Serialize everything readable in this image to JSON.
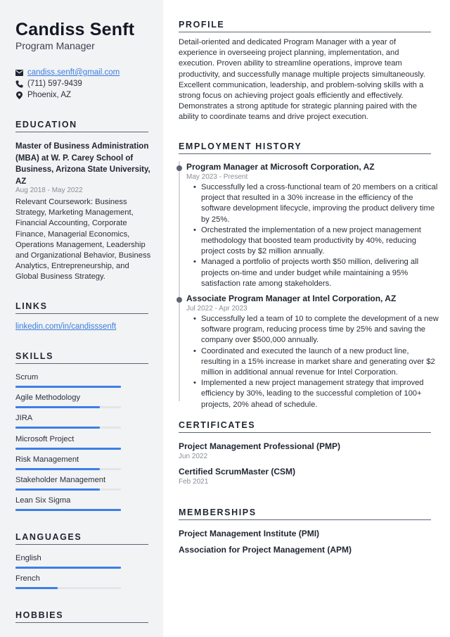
{
  "header": {
    "name": "Candiss Senft",
    "role": "Program Manager"
  },
  "contact": {
    "email": "candiss.senft@gmail.com",
    "phone": "(711) 597-9439",
    "location": "Phoenix, AZ",
    "icons": [
      "envelope-icon",
      "phone-icon",
      "location-pin-icon"
    ]
  },
  "sidebar": {
    "education": {
      "heading": "EDUCATION",
      "degree": "Master of Business Administration (MBA) at W. P. Carey School of Business, Arizona State University, AZ",
      "dates": "Aug 2018 - May 2022",
      "description": "Relevant Coursework: Business Strategy, Marketing Management, Financial Accounting, Corporate Finance, Managerial Economics, Operations Management, Leadership and Organizational Behavior, Business Analytics, Entrepreneurship, and Global Business Strategy."
    },
    "links": {
      "heading": "LINKS",
      "items": [
        "linkedin.com/in/candisssenft"
      ]
    },
    "skills": {
      "heading": "SKILLS",
      "items": [
        {
          "label": "Scrum",
          "level": 1.0
        },
        {
          "label": "Agile Methodology",
          "level": 0.8
        },
        {
          "label": "JIRA",
          "level": 0.8
        },
        {
          "label": "Microsoft Project",
          "level": 1.0
        },
        {
          "label": "Risk Management",
          "level": 0.8
        },
        {
          "label": "Stakeholder Management",
          "level": 0.8
        },
        {
          "label": "Lean Six Sigma",
          "level": 1.0
        }
      ]
    },
    "languages": {
      "heading": "LANGUAGES",
      "items": [
        {
          "label": "English",
          "level": 1.0
        },
        {
          "label": "French",
          "level": 0.4
        }
      ]
    },
    "hobbies": {
      "heading": "HOBBIES"
    }
  },
  "main": {
    "profile": {
      "heading": "PROFILE",
      "text": "Detail-oriented and dedicated Program Manager with a year of experience in overseeing project planning, implementation, and execution. Proven ability to streamline operations, improve team productivity, and successfully manage multiple projects simultaneously. Excellent communication, leadership, and problem-solving skills with a strong focus on achieving project goals efficiently and effectively. Demonstrates a strong aptitude for strategic planning paired with the ability to coordinate teams and drive project execution."
    },
    "employment": {
      "heading": "EMPLOYMENT HISTORY",
      "jobs": [
        {
          "title": "Program Manager at Microsoft Corporation, AZ",
          "dates": "May 2023 - Present",
          "bullets": [
            "Successfully led a cross-functional team of 20 members on a critical project that resulted in a 30% increase in the efficiency of the software development lifecycle, improving the product delivery time by 25%.",
            "Orchestrated the implementation of a new project management methodology that boosted team productivity by 40%, reducing project costs by $2 million annually.",
            "Managed a portfolio of projects worth $50 million, delivering all projects on-time and under budget while maintaining a 95% satisfaction rate among stakeholders."
          ]
        },
        {
          "title": "Associate Program Manager at Intel Corporation, AZ",
          "dates": "Jul 2022 - Apr 2023",
          "bullets": [
            "Successfully led a team of 10 to complete the development of a new software program, reducing process time by 25% and saving the company over $500,000 annually.",
            "Coordinated and executed the launch of a new product line, resulting in a 15% increase in market share and generating over $2 million in additional annual revenue for Intel Corporation.",
            "Implemented a new project management strategy that improved efficiency by 30%, leading to the successful completion of 100+ projects, 20% ahead of schedule."
          ]
        }
      ]
    },
    "certificates": {
      "heading": "CERTIFICATES",
      "items": [
        {
          "title": "Project Management Professional (PMP)",
          "date": "Jun 2022"
        },
        {
          "title": "Certified ScrumMaster (CSM)",
          "date": "Feb 2021"
        }
      ]
    },
    "memberships": {
      "heading": "MEMBERSHIPS",
      "items": [
        "Project Management Institute (PMI)",
        "Association for Project Management (APM)"
      ]
    }
  },
  "colors": {
    "accent": "#3d7fe6",
    "link": "#3b7ddd",
    "sidebar_bg": "#f2f3f5",
    "text": "#1f2430",
    "muted": "#8a8e98"
  }
}
